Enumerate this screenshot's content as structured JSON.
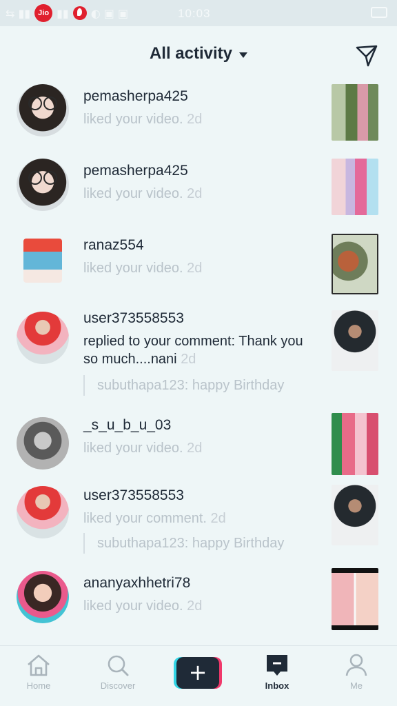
{
  "status_bar": {
    "carrier_badge": "Jio",
    "time": "10:03"
  },
  "header": {
    "title": "All activity",
    "filter_icon": "send-filter-icon"
  },
  "activities": [
    {
      "username": "pemasherpa425",
      "action": "liked your video.",
      "age": "2d"
    },
    {
      "username": "pemasherpa425",
      "action": "liked your video.",
      "age": "2d"
    },
    {
      "username": "ranaz554",
      "action": "liked your video.",
      "age": "2d"
    },
    {
      "username": "user373558553",
      "action": "replied to your comment: Thank you so much....nani",
      "age": "2d",
      "quote": "subuthapa123: happy Birthday"
    },
    {
      "username": "_s_u_b_u_03",
      "action": "liked your video.",
      "age": "2d"
    },
    {
      "username": "user373558553",
      "action": "liked your comment.",
      "age": "2d",
      "quote": "subuthapa123: happy Birthday"
    },
    {
      "username": "ananyaxhhetri78",
      "action": "liked your video.",
      "age": "2d"
    }
  ],
  "bottom_nav": {
    "home": "Home",
    "discover": "Discover",
    "create": "+",
    "inbox": "Inbox",
    "me": "Me"
  },
  "colors": {
    "background": "#eef6f7",
    "text_primary": "#1f2a37",
    "text_muted": "#b9c3ca",
    "create_cyan": "#33d6e6",
    "create_pink": "#f0386b"
  }
}
